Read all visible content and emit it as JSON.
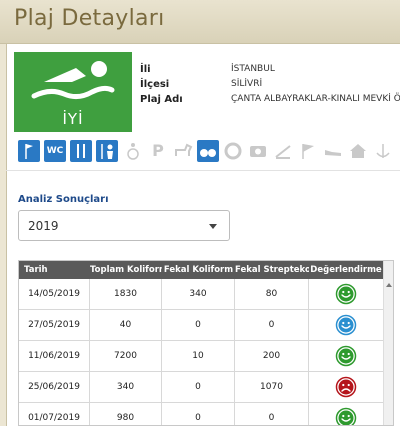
{
  "page": {
    "title": "Plaj Detayları"
  },
  "beach": {
    "quality_label": "İYİ",
    "fields": [
      {
        "label": "İli",
        "value": "İSTANBUL"
      },
      {
        "label": "İlçesi",
        "value": "SİLİVRİ"
      },
      {
        "label": "Plaj Adı",
        "value": "ÇANTA ALBAYRAKLAR-KINALI MEVKİ ÖNÜ"
      }
    ]
  },
  "facilities": [
    {
      "name": "flag-icon",
      "active": true
    },
    {
      "name": "wc-icon",
      "label": "WC",
      "active": true
    },
    {
      "name": "restaurant-icon",
      "active": true
    },
    {
      "name": "lifeguard-icon",
      "active": true
    },
    {
      "name": "wheelchair-icon",
      "active": false
    },
    {
      "name": "parking-icon",
      "label": "P",
      "active": false
    },
    {
      "name": "dog-icon",
      "active": false
    },
    {
      "name": "binoculars-icon",
      "active": true
    },
    {
      "name": "lifebuoy-icon",
      "active": false
    },
    {
      "name": "first-aid-icon",
      "active": false
    },
    {
      "name": "shower-icon",
      "active": false
    },
    {
      "name": "white-flag-icon",
      "active": false
    },
    {
      "name": "shoe-icon",
      "active": false
    },
    {
      "name": "house-icon",
      "active": false
    },
    {
      "name": "anchor-icon",
      "active": false
    }
  ],
  "analysis": {
    "label": "Analiz Sonuçları",
    "selected_year": "2019",
    "columns": [
      "Tarih",
      "Toplam Koliform",
      "Fekal Koliform",
      "Fekal Streptekok",
      "Değerlendirme"
    ],
    "rows": [
      {
        "date": "14/05/2019",
        "total": "1830",
        "fekal_k": "340",
        "fekal_s": "80",
        "rating": "good"
      },
      {
        "date": "27/05/2019",
        "total": "40",
        "fekal_k": "0",
        "fekal_s": "0",
        "rating": "excellent"
      },
      {
        "date": "11/06/2019",
        "total": "7200",
        "fekal_k": "10",
        "fekal_s": "200",
        "rating": "good"
      },
      {
        "date": "25/06/2019",
        "total": "340",
        "fekal_k": "0",
        "fekal_s": "1070",
        "rating": "poor"
      },
      {
        "date": "01/07/2019",
        "total": "980",
        "fekal_k": "0",
        "fekal_s": "0",
        "rating": "good"
      }
    ],
    "rating_colors": {
      "good": "#2e9a2e",
      "excellent": "#2a8fd0",
      "poor": "#b5151b"
    }
  },
  "colors": {
    "accent": "#2a79c4",
    "logo_bg": "#3f9f3f",
    "title_text": "#7a6a3e",
    "header_bg": "#5a5a5a"
  }
}
